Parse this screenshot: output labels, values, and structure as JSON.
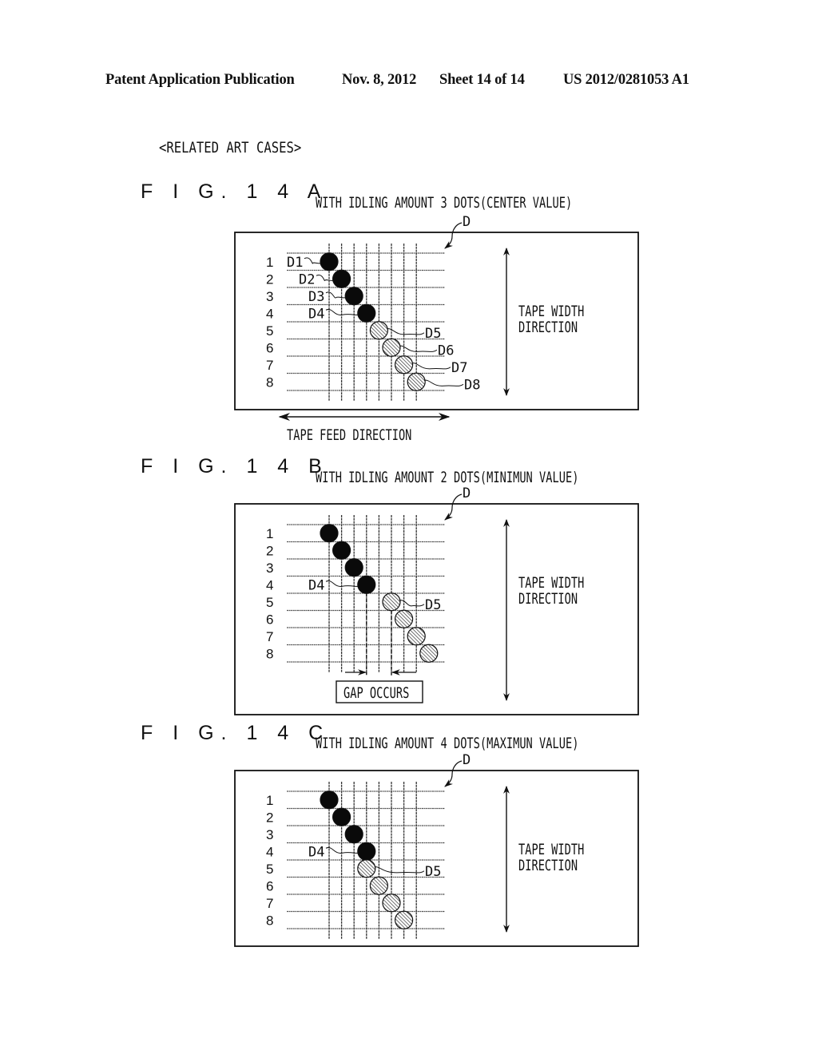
{
  "header": {
    "publication": "Patent Application Publication",
    "date": "Nov. 8, 2012",
    "sheet": "Sheet 14 of 14",
    "number": "US 2012/0281053 A1"
  },
  "section_title": "<RELATED ART CASES>",
  "common": {
    "row_labels": [
      "1",
      "2",
      "3",
      "4",
      "5",
      "6",
      "7",
      "8"
    ],
    "grid_columns": 8,
    "grid_rows": 8,
    "tape_width_direction": [
      "TAPE WIDTH",
      "DIRECTION"
    ],
    "tape_feed_direction": "TAPE FEED DIRECTION",
    "dot_group_label": "D",
    "dot_styles": {
      "rows_1_4": "solid-black",
      "rows_5_8": "hatched"
    }
  },
  "figures": [
    {
      "id": "14A",
      "label": "F I G. 1 4 A",
      "caption": "WITH IDLING AMOUNT 3 DOTS(CENTER VALUE)",
      "idling_amount_dots": 3,
      "dot_columns": [
        1,
        2,
        3,
        4,
        5,
        6,
        7,
        8
      ],
      "dot_labels": [
        "D1",
        "D2",
        "D3",
        "D4",
        "D5",
        "D6",
        "D7",
        "D8"
      ],
      "show_feed_direction": true,
      "gap_note": null
    },
    {
      "id": "14B",
      "label": "F I G. 1 4 B",
      "caption": "WITH IDLING AMOUNT 2 DOTS(MINIMUN VALUE)",
      "idling_amount_dots": 2,
      "dot_columns": [
        1,
        2,
        3,
        4,
        6,
        7,
        8,
        9
      ],
      "dot_labels": [
        "",
        "",
        "",
        "D4",
        "D5",
        "",
        "",
        ""
      ],
      "show_feed_direction": false,
      "gap_note": "GAP OCCURS"
    },
    {
      "id": "14C",
      "label": "F I G. 1 4 C",
      "caption": "WITH IDLING AMOUNT 4 DOTS(MAXIMUN VALUE)",
      "idling_amount_dots": 4,
      "dot_columns": [
        1,
        2,
        3,
        4,
        4,
        5,
        6,
        7
      ],
      "dot_labels": [
        "",
        "",
        "",
        "D4",
        "D5",
        "",
        "",
        ""
      ],
      "show_feed_direction": false,
      "gap_note": null
    }
  ]
}
